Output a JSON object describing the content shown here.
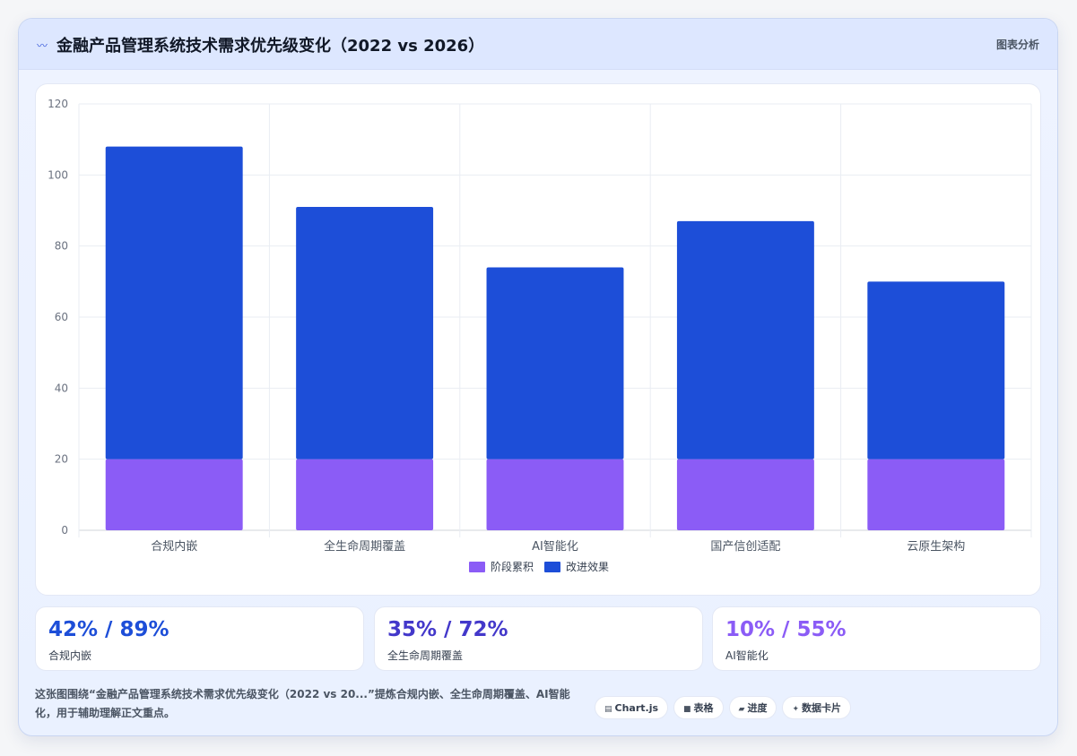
{
  "header": {
    "icon": "pulse-icon",
    "title": "金融产品管理系统技术需求优先级变化（2022 vs 2026）",
    "tag": "图表分析"
  },
  "chart_data": {
    "type": "bar",
    "stacked": true,
    "categories": [
      "合规内嵌",
      "全生命周期覆盖",
      "AI智能化",
      "国产信创适配",
      "云原生架构"
    ],
    "series": [
      {
        "name": "阶段累积",
        "color": "#8b5cf6",
        "values": [
          20,
          20,
          20,
          20,
          20
        ]
      },
      {
        "name": "改进效果",
        "color": "#1d4ed8",
        "values": [
          88,
          71,
          54,
          67,
          50
        ]
      }
    ],
    "ylim": [
      0,
      120
    ],
    "yticks": [
      0,
      20,
      40,
      60,
      80,
      100,
      120
    ],
    "grid": true,
    "legend": "bottom"
  },
  "stats": [
    {
      "value": "42% / 89%",
      "label": "合规内嵌",
      "color": "#1d4ed8"
    },
    {
      "value": "35% / 72%",
      "label": "全生命周期覆盖",
      "color": "#4338ca"
    },
    {
      "value": "10% / 55%",
      "label": "AI智能化",
      "color": "#8b5cf6"
    }
  ],
  "footer": {
    "text": "这张图围绕“金融产品管理系统技术需求优先级变化（2022 vs 20...”提炼合规内嵌、全生命周期覆盖、AI智能化，用于辅助理解正文重点。",
    "pills": [
      {
        "icon": "chart-icon",
        "glyph": "▤",
        "label": "Chart.js"
      },
      {
        "icon": "table-icon",
        "glyph": "■",
        "label": "表格"
      },
      {
        "icon": "progress-icon",
        "glyph": "▰",
        "label": "进度"
      },
      {
        "icon": "sparkle-icon",
        "glyph": "✦",
        "label": "数据卡片"
      }
    ]
  }
}
